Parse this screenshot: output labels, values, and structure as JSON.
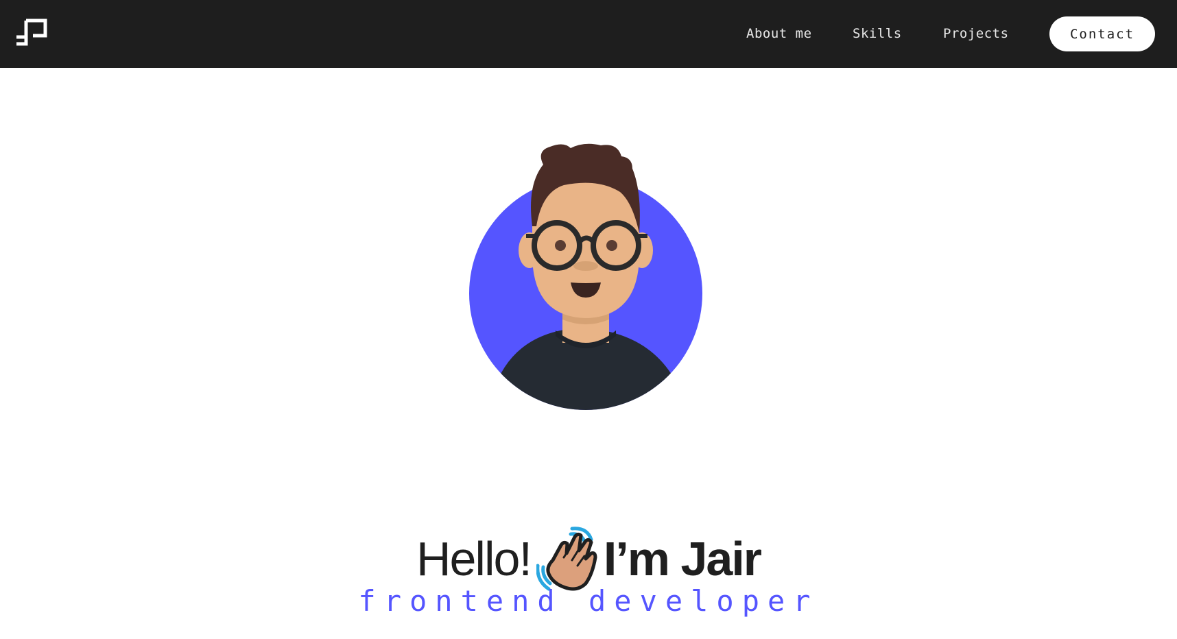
{
  "nav": {
    "links": [
      {
        "label": "About me"
      },
      {
        "label": "Skills"
      },
      {
        "label": "Projects"
      }
    ],
    "contact_label": "Contact"
  },
  "hero": {
    "greeting": "Hello!",
    "name": "I’m Jair",
    "role": "frontend developer",
    "wave_icon": "waving-hand-icon"
  },
  "colors": {
    "navbar_bg": "#1e1e1e",
    "accent": "#5555ff",
    "text": "#1f1f1f"
  }
}
